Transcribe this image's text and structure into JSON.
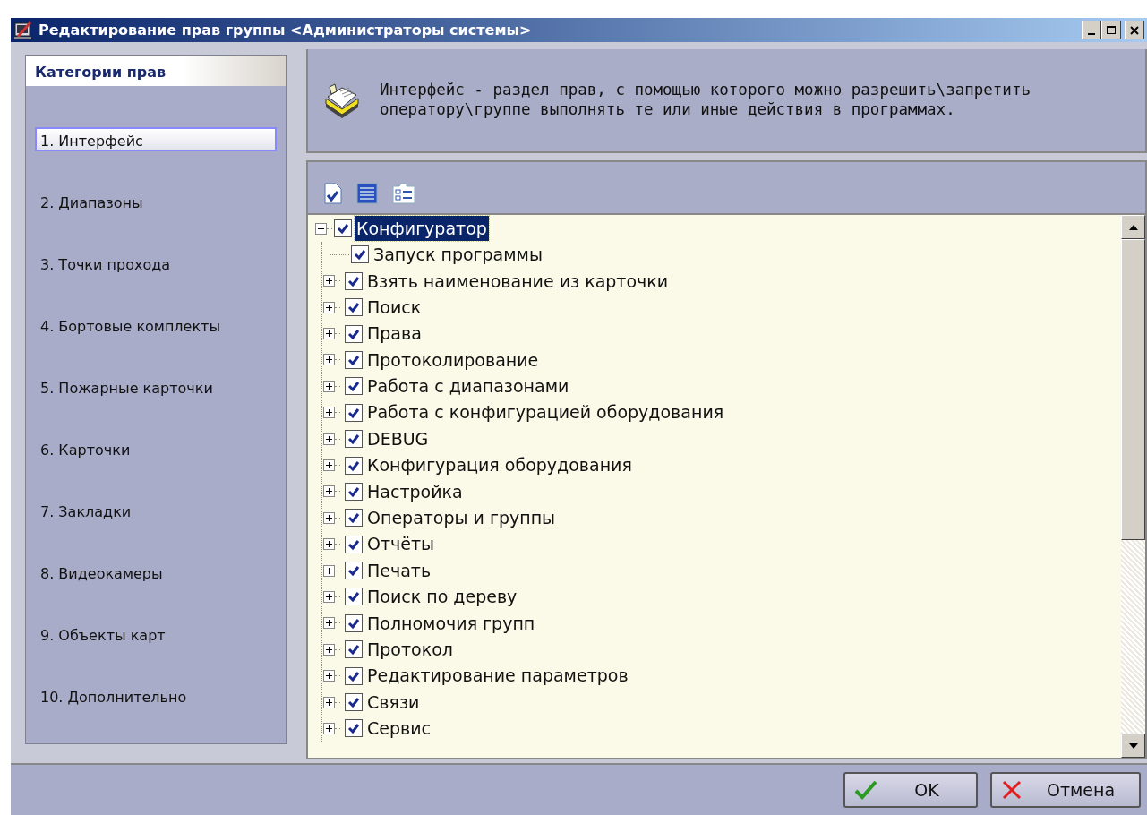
{
  "window": {
    "title": "Редактирование прав группы <Администраторы системы>"
  },
  "sidebar": {
    "title": "Категории прав",
    "items": [
      {
        "label": "1.  Интерфейс",
        "selected": true
      },
      {
        "label": "2.  Диапазоны",
        "selected": false
      },
      {
        "label": "3.  Точки прохода",
        "selected": false
      },
      {
        "label": "4.  Бортовые комплекты",
        "selected": false
      },
      {
        "label": "5.  Пожарные карточки",
        "selected": false
      },
      {
        "label": "6.  Карточки",
        "selected": false
      },
      {
        "label": "7.  Закладки",
        "selected": false
      },
      {
        "label": "8.  Видеокамеры",
        "selected": false
      },
      {
        "label": "9.  Объекты карт",
        "selected": false
      },
      {
        "label": "10. Дополнительно",
        "selected": false
      }
    ]
  },
  "description": "Интерфейс - раздел прав, с помощью которого можно разрешить\\запретить оператору\\группе выполнять те или иные действия в программах.",
  "tree": [
    {
      "label": "Конфигуратор",
      "checked": true,
      "selected": true,
      "expanded": true,
      "children": [
        {
          "label": "Запуск программы",
          "kind": "leaf",
          "checked": true,
          "selected": false
        },
        {
          "label": "Взять наименование из карточки",
          "kind": "group",
          "checked": true,
          "selected": false,
          "expanded": false
        },
        {
          "label": "Поиск",
          "kind": "group",
          "checked": true,
          "selected": false,
          "expanded": false
        },
        {
          "label": "Права",
          "kind": "group",
          "checked": true,
          "selected": false,
          "expanded": false
        },
        {
          "label": "Протоколирование",
          "kind": "group",
          "checked": true,
          "selected": false,
          "expanded": false
        },
        {
          "label": "Работа с диапазонами",
          "kind": "group",
          "checked": true,
          "selected": false,
          "expanded": false
        },
        {
          "label": "Работа с конфигурацией оборудования",
          "kind": "group",
          "checked": true,
          "selected": false,
          "expanded": false
        },
        {
          "label": "DEBUG",
          "kind": "group",
          "checked": true,
          "selected": false,
          "expanded": false
        },
        {
          "label": "Конфигурация оборудования",
          "kind": "group",
          "checked": true,
          "selected": false,
          "expanded": false
        },
        {
          "label": "Настройка",
          "kind": "group",
          "checked": true,
          "selected": false,
          "expanded": false
        },
        {
          "label": "Операторы и группы",
          "kind": "group",
          "checked": true,
          "selected": false,
          "expanded": false
        },
        {
          "label": "Отчёты",
          "kind": "group",
          "checked": true,
          "selected": false,
          "expanded": false
        },
        {
          "label": "Печать",
          "kind": "group",
          "checked": true,
          "selected": false,
          "expanded": false
        },
        {
          "label": "Поиск по дереву",
          "kind": "group",
          "checked": true,
          "selected": false,
          "expanded": false
        },
        {
          "label": "Полномочия групп",
          "kind": "group",
          "checked": true,
          "selected": false,
          "expanded": false
        },
        {
          "label": "Протокол",
          "kind": "group",
          "checked": true,
          "selected": false,
          "expanded": false
        },
        {
          "label": "Редактирование параметров",
          "kind": "group",
          "checked": true,
          "selected": false,
          "expanded": false
        },
        {
          "label": "Связи",
          "kind": "group",
          "checked": true,
          "selected": false,
          "expanded": false
        },
        {
          "label": "Сервис",
          "kind": "group",
          "checked": true,
          "selected": false,
          "expanded": false
        }
      ]
    }
  ],
  "buttons": [
    {
      "label": "OK",
      "kind": "ok"
    },
    {
      "label": "Отмена",
      "kind": "cancel"
    }
  ]
}
